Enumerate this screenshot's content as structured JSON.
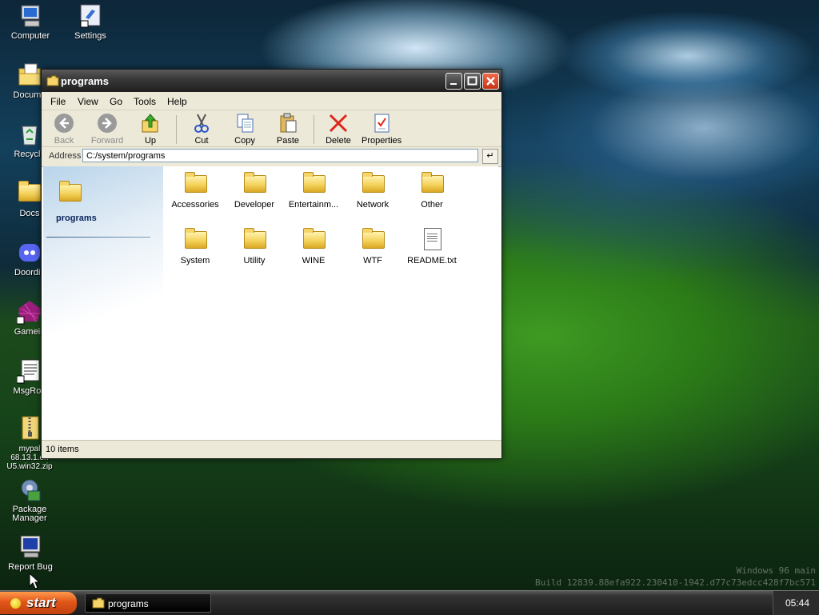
{
  "desktop": {
    "icons": [
      {
        "label": "Computer",
        "icon": "computer-icon"
      },
      {
        "label": "Settings",
        "icon": "settings-icon"
      },
      {
        "label": "Docume",
        "icon": "documents-icon"
      },
      {
        "label": "Recycle",
        "icon": "recycle-bin-icon"
      },
      {
        "label": "Docs",
        "icon": "folder-icon"
      },
      {
        "label": "Doordis",
        "icon": "discord-icon"
      },
      {
        "label": "Gamein",
        "icon": "game-icon"
      },
      {
        "label": "MsgRoo",
        "icon": "message-icon"
      },
      {
        "label": "mypal 68.13.1.en U5.win32.zip",
        "icon": "zip-icon"
      },
      {
        "label": "Package Manager",
        "icon": "package-manager-icon"
      },
      {
        "label": "Report Bug",
        "icon": "report-bug-icon"
      }
    ],
    "watermark_line1": "Windows 96 main",
    "watermark_line2": "Build 12839.88efa922.230410-1942.d77c73edcc428f7bc571"
  },
  "window": {
    "title": "programs",
    "menu": [
      "File",
      "View",
      "Go",
      "Tools",
      "Help"
    ],
    "toolbar": {
      "back": "Back",
      "forward": "Forward",
      "up": "Up",
      "cut": "Cut",
      "copy": "Copy",
      "paste": "Paste",
      "delete": "Delete",
      "properties": "Properties"
    },
    "address_label": "Address",
    "address_value": "C:/system/programs",
    "side_panel_title": "programs",
    "items": [
      {
        "label": "Accessories",
        "type": "folder"
      },
      {
        "label": "Developer",
        "type": "folder"
      },
      {
        "label": "Entertainm...",
        "type": "folder"
      },
      {
        "label": "Network",
        "type": "folder"
      },
      {
        "label": "Other",
        "type": "folder"
      },
      {
        "label": "System",
        "type": "folder"
      },
      {
        "label": "Utility",
        "type": "folder"
      },
      {
        "label": "WINE",
        "type": "folder"
      },
      {
        "label": "WTF",
        "type": "folder"
      },
      {
        "label": "README.txt",
        "type": "text-file"
      }
    ],
    "status": "10 items"
  },
  "taskbar": {
    "start_label": "start",
    "task_label": "programs",
    "clock": "05:44"
  },
  "colors": {
    "start_button": "#e1561a",
    "close_button": "#c83214",
    "folder": "#f2cf55"
  }
}
